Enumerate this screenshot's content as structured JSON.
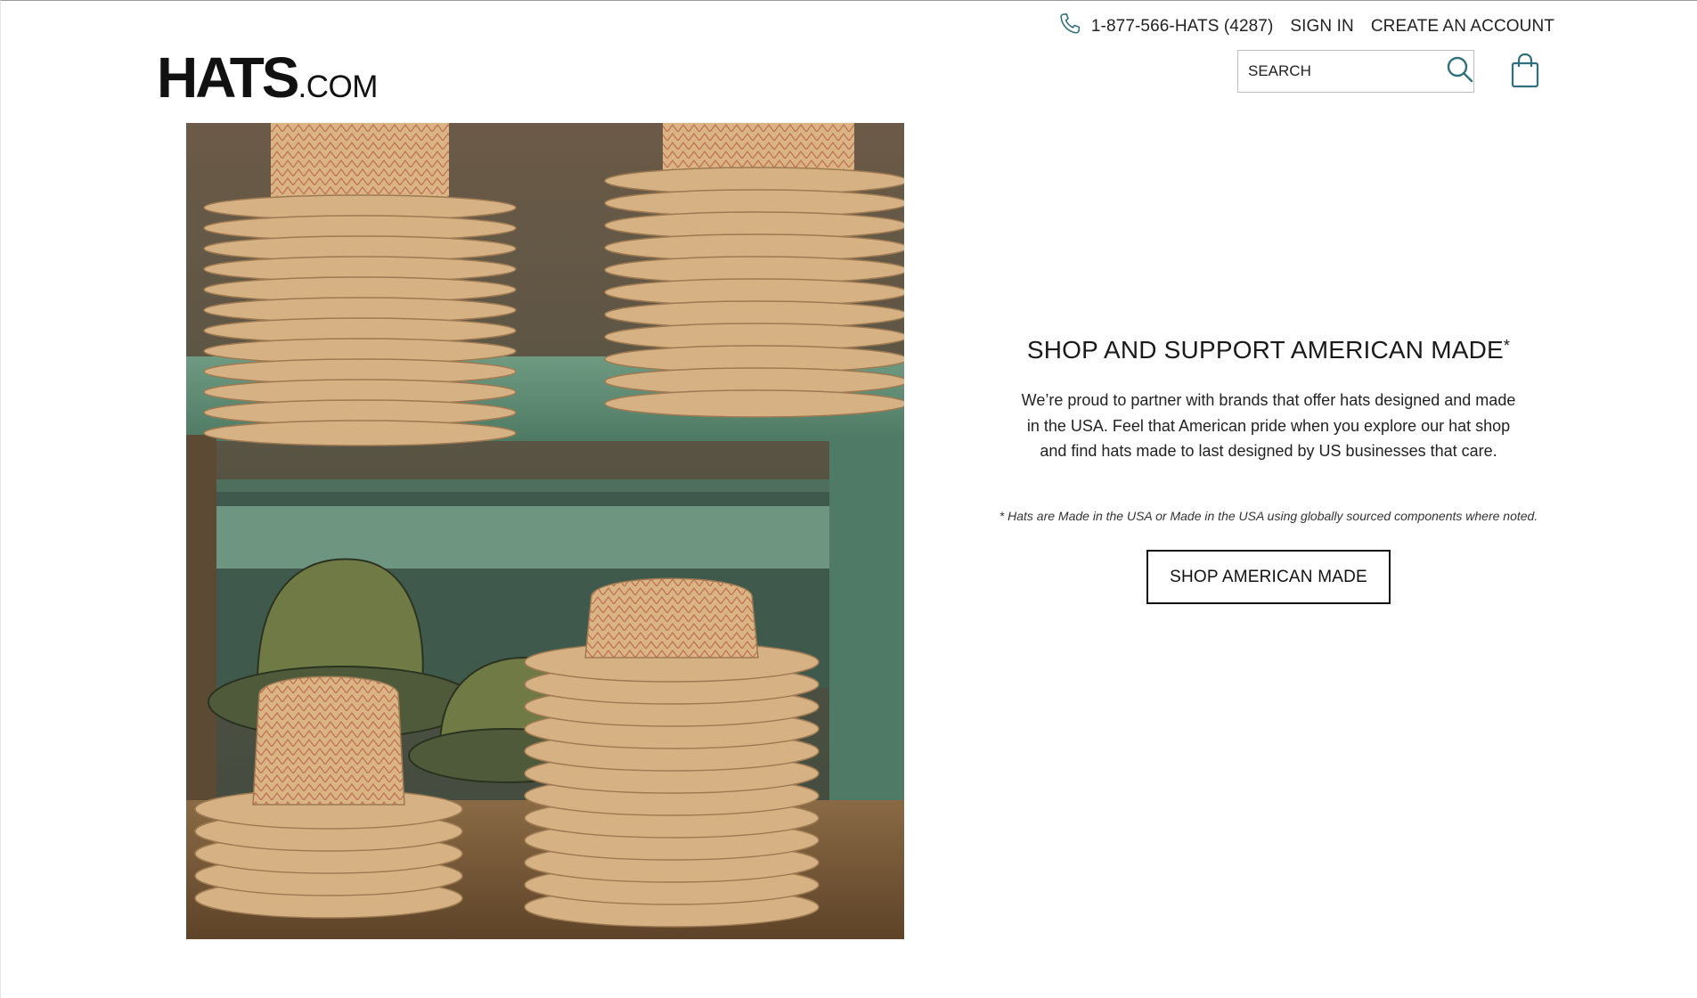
{
  "header": {
    "phone": "1-877-566-HATS (4287)",
    "sign_in": "SIGN IN",
    "create_account": "CREATE AN ACCOUNT",
    "logo": {
      "main": "HATS",
      "suffix": ".COM"
    },
    "search": {
      "placeholder": "SEARCH",
      "value": ""
    },
    "icons": {
      "phone": "phone-icon",
      "search": "search-icon",
      "cart": "shopping-bag-icon"
    }
  },
  "hero": {
    "image_subject": "stacked straw hats on green shelves"
  },
  "promo": {
    "title": "SHOP AND SUPPORT AMERICAN MADE",
    "title_mark": "*",
    "body": "We’re proud to partner with brands that offer hats designed and made in the USA. Feel that American pride when you explore our hat shop and find hats made to last designed by US businesses that care.",
    "note": "* Hats are Made in the USA or Made in the USA using globally sourced components where noted.",
    "cta_label": "SHOP AMERICAN MADE"
  },
  "colors": {
    "accent": "#2f6f7e",
    "text": "#222222",
    "shelf_green": "#5e8a72",
    "straw": "#d9b07f"
  }
}
